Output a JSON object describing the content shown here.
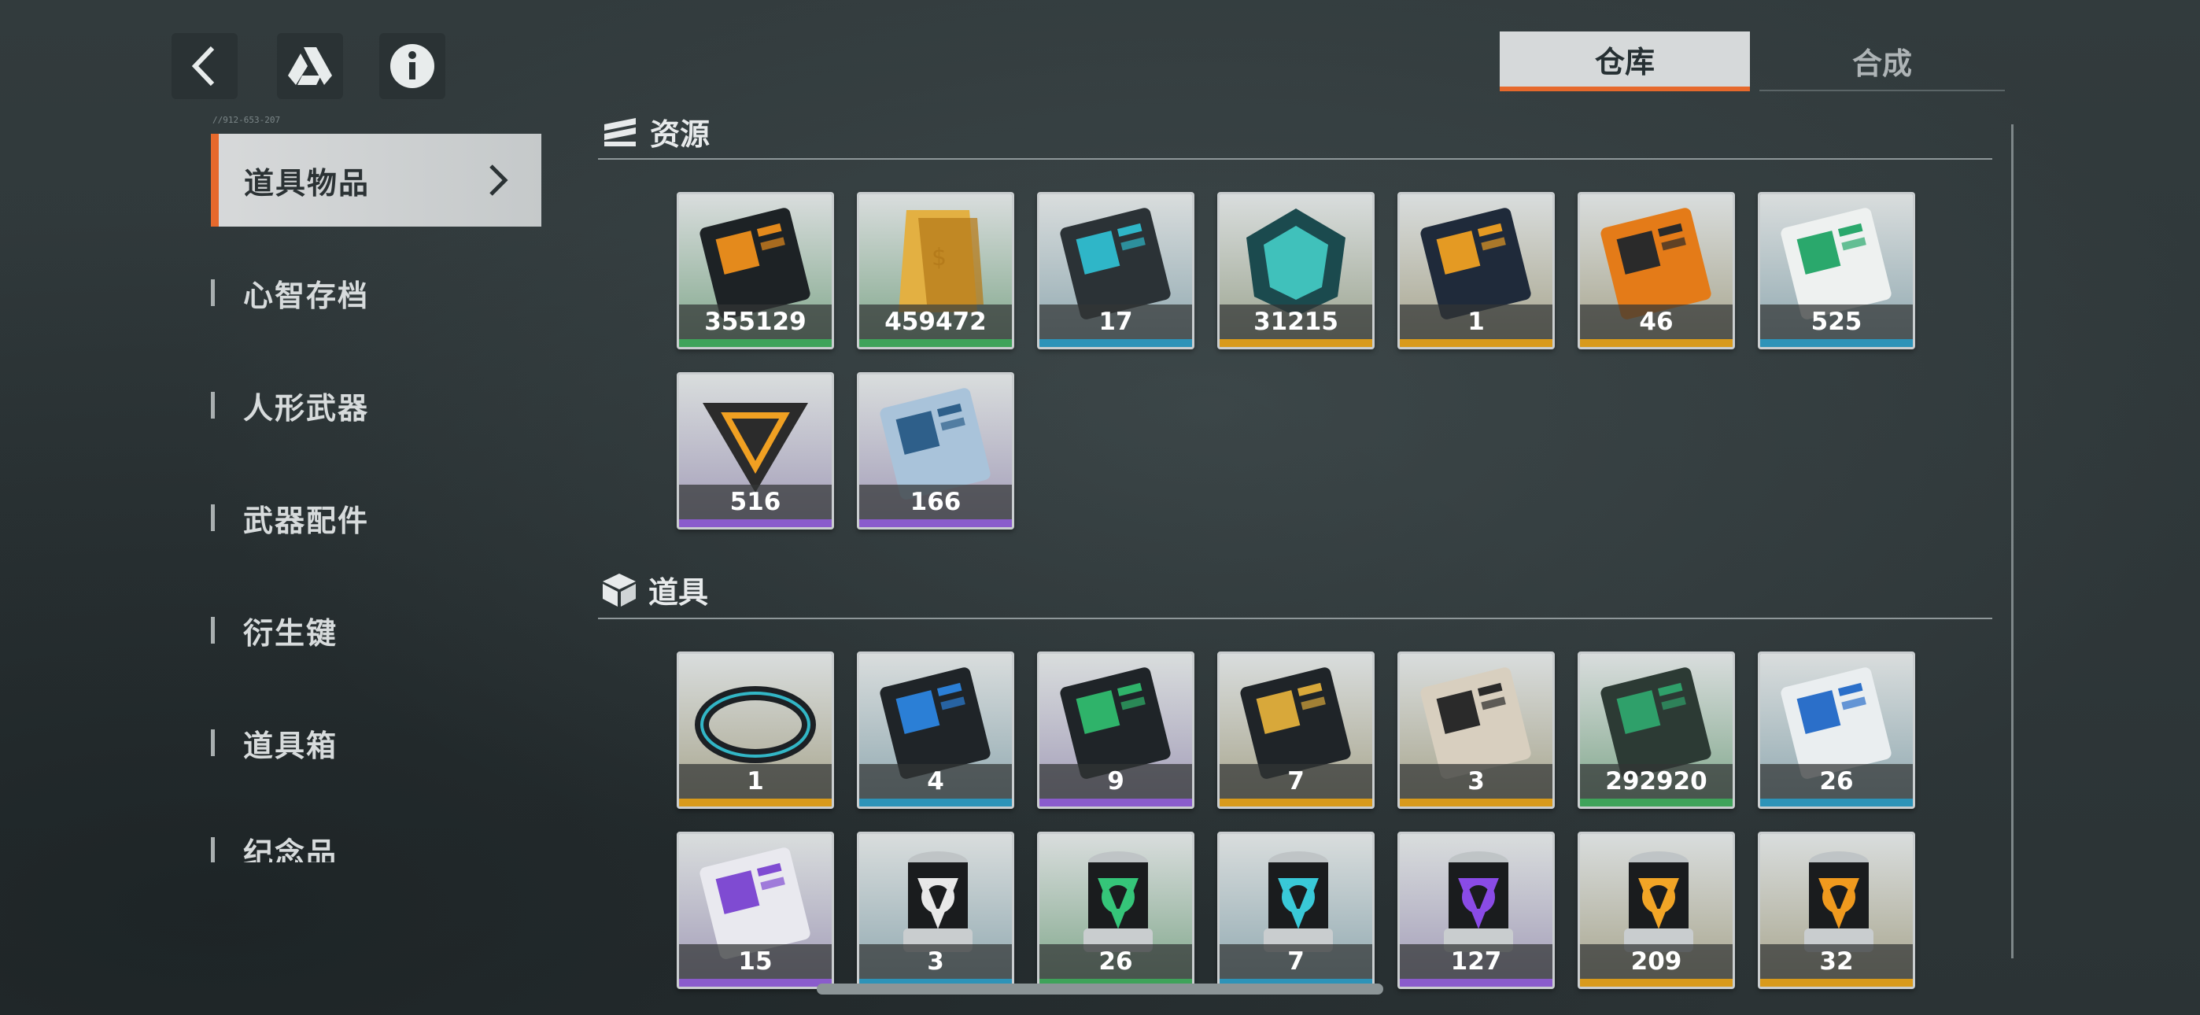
{
  "header": {
    "back_icon": "chevron-left-icon",
    "drive_icon": "triangle-logo-icon",
    "info_icon": "info-icon",
    "code_text": "//912-653-207"
  },
  "tabs": [
    {
      "label": "仓库",
      "active": true
    },
    {
      "label": "合成",
      "active": false
    }
  ],
  "sidebar": {
    "items": [
      {
        "label": "道具物品",
        "active": true
      },
      {
        "label": "心智存档"
      },
      {
        "label": "人形武器"
      },
      {
        "label": "武器配件"
      },
      {
        "label": "衍生键"
      },
      {
        "label": "道具箱"
      },
      {
        "label": "纪念品"
      }
    ]
  },
  "sections": [
    {
      "title": "资源",
      "icon": "stack-icon",
      "items": [
        {
          "icon": "orange-black-card-icon",
          "qty": "355129",
          "rarity": "#3fa35a"
        },
        {
          "icon": "gold-bar-icon",
          "qty": "459472",
          "rarity": "#3fa35a"
        },
        {
          "icon": "usb-drive-icon",
          "qty": "17",
          "rarity": "#2d93b8"
        },
        {
          "icon": "cyan-crystal-icon",
          "qty": "31215",
          "rarity": "#d89a1c"
        },
        {
          "icon": "dark-ticket-icon",
          "qty": "1",
          "rarity": "#d89a1c"
        },
        {
          "icon": "orange-ticket-icon",
          "qty": "46",
          "rarity": "#d89a1c"
        },
        {
          "icon": "green-pass-card-icon",
          "qty": "525",
          "rarity": "#2d93b8"
        },
        {
          "icon": "triangle-emblem-icon",
          "qty": "516",
          "rarity": "#8a5ccc"
        },
        {
          "icon": "holo-card-icon",
          "qty": "166",
          "rarity": "#8a5ccc"
        }
      ]
    },
    {
      "title": "道具",
      "icon": "cube-icon",
      "items": [
        {
          "icon": "bracelet-icon",
          "qty": "1",
          "rarity": "#d89a1c"
        },
        {
          "icon": "blue-chip-card-icon",
          "qty": "4",
          "rarity": "#2d93b8"
        },
        {
          "icon": "green-chip-card-icon",
          "qty": "9",
          "rarity": "#8a5ccc"
        },
        {
          "icon": "gold-chip-card-icon",
          "qty": "7",
          "rarity": "#d89a1c"
        },
        {
          "icon": "ticket-stack-icon",
          "qty": "3",
          "rarity": "#d89a1c"
        },
        {
          "icon": "green-box-icon",
          "qty": "292920",
          "rarity": "#3fa35a"
        },
        {
          "icon": "blue-diamond-card-icon",
          "qty": "26",
          "rarity": "#2d93b8"
        },
        {
          "icon": "purple-diamond-card-icon",
          "qty": "15",
          "rarity": "#8a5ccc"
        },
        {
          "icon": "white-canister-icon",
          "qty": "3",
          "rarity": "#2d93b8"
        },
        {
          "icon": "green-canister-icon",
          "qty": "26",
          "rarity": "#3fa35a"
        },
        {
          "icon": "cyan-canister-icon",
          "qty": "7",
          "rarity": "#2d93b8"
        },
        {
          "icon": "purple-canister-icon",
          "qty": "127",
          "rarity": "#8a5ccc"
        },
        {
          "icon": "gold-canister-icon",
          "qty": "209",
          "rarity": "#d89a1c"
        },
        {
          "icon": "orange-canister-icon",
          "qty": "32",
          "rarity": "#d89a1c"
        }
      ]
    }
  ]
}
